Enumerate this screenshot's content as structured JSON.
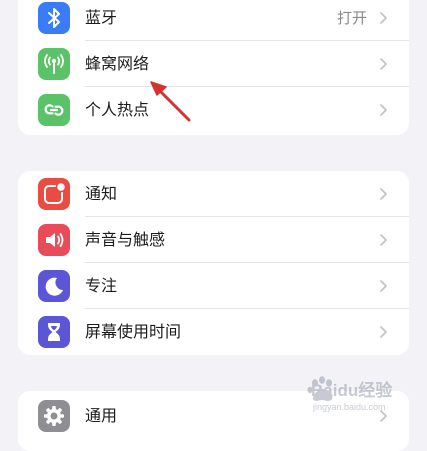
{
  "settings": {
    "connectivity": [
      {
        "label": "蓝牙",
        "value": "打开",
        "icon": "bluetooth-icon",
        "color": "#3a7bf6"
      },
      {
        "label": "蜂窝网络",
        "value": "",
        "icon": "antenna-icon",
        "color": "#5ac267"
      },
      {
        "label": "个人热点",
        "value": "",
        "icon": "link-chain-icon",
        "color": "#5ac267"
      }
    ],
    "notifications": [
      {
        "label": "通知",
        "icon": "notification-badge-icon",
        "color": "#ea4b43"
      },
      {
        "label": "声音与触感",
        "icon": "speaker-icon",
        "color": "#ea4b59"
      },
      {
        "label": "专注",
        "icon": "crescent-moon-icon",
        "color": "#5b56d6"
      },
      {
        "label": "屏幕使用时间",
        "icon": "hourglass-icon",
        "color": "#5b56d6"
      }
    ],
    "general": [
      {
        "label": "通用",
        "icon": "gear-icon",
        "color": "#8e8e93"
      }
    ]
  },
  "annotation": {
    "arrow_color": "#d63030"
  },
  "watermark": {
    "text": "Baidu经验",
    "subtext": "jingyan.baidu.com"
  }
}
